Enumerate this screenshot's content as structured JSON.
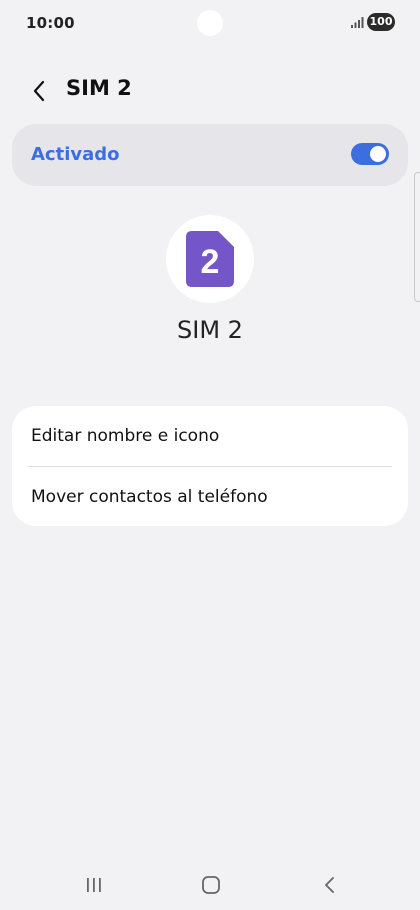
{
  "status_bar": {
    "time": "10:00",
    "battery": "100",
    "signal_icon": "signal-bars-icon"
  },
  "header": {
    "back_icon": "chevron-left-icon",
    "title": "SIM 2"
  },
  "master_switch": {
    "label": "Activado",
    "enabled": true,
    "accent_color": "#3d6ee0"
  },
  "sim": {
    "icon": "sim-card-icon",
    "icon_number": "2",
    "icon_color": "#7556c8",
    "name": "SIM 2"
  },
  "options": [
    {
      "label": "Editar nombre e icono"
    },
    {
      "label": "Mover contactos al teléfono"
    }
  ],
  "nav_bar": {
    "recents_icon": "recents-icon",
    "home_icon": "home-icon",
    "back_icon": "back-icon"
  }
}
